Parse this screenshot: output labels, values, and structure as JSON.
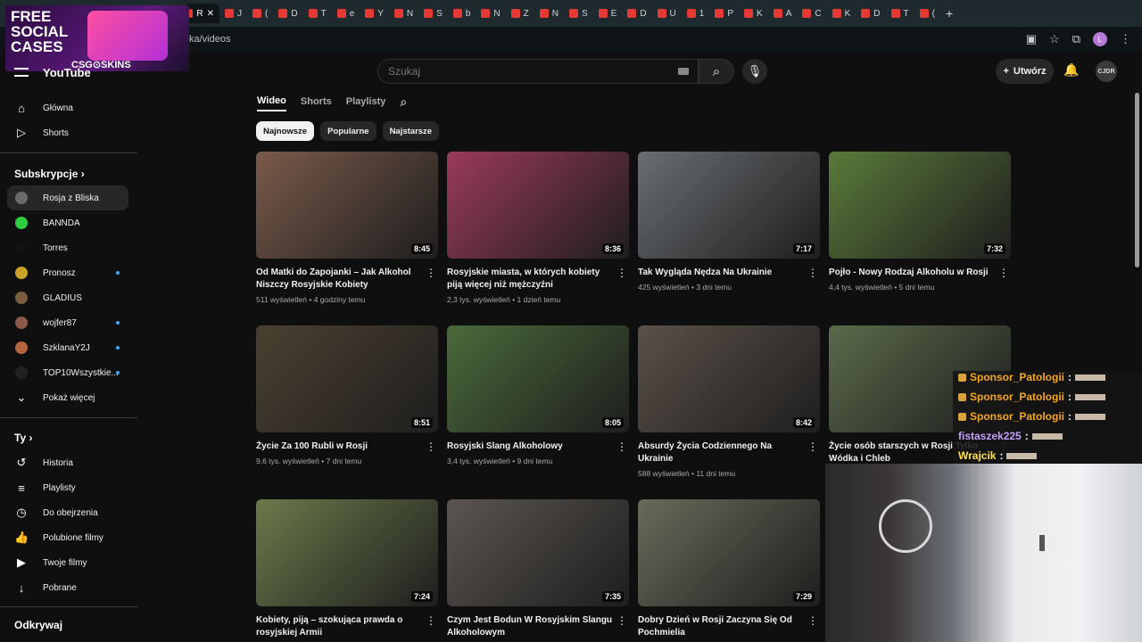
{
  "tabs": [
    {
      "label": "R",
      "active": true
    },
    {
      "label": "J"
    },
    {
      "label": "("
    },
    {
      "label": "D"
    },
    {
      "label": "T"
    },
    {
      "label": "e"
    },
    {
      "label": "Y"
    },
    {
      "label": "N"
    },
    {
      "label": "S"
    },
    {
      "label": "b"
    },
    {
      "label": "N"
    },
    {
      "label": "Z"
    },
    {
      "label": "N"
    },
    {
      "label": "S"
    },
    {
      "label": "E"
    },
    {
      "label": "D"
    },
    {
      "label": "U"
    },
    {
      "label": "1"
    },
    {
      "label": "P"
    },
    {
      "label": "K"
    },
    {
      "label": "A"
    },
    {
      "label": "C"
    },
    {
      "label": "K"
    },
    {
      "label": "D"
    },
    {
      "label": "T"
    },
    {
      "label": "("
    }
  ],
  "url": "ka/videos",
  "profile_letter": "L",
  "ad": {
    "title": "FREE\nSOCIAL\nCASES",
    "brand": "CSG⊙SKINS"
  },
  "header": {
    "logo": "YouTube",
    "search_placeholder": "Szukaj",
    "create_label": "Utwórz",
    "avatar_text": "CJDR"
  },
  "sidebar": {
    "main": [
      {
        "icon": "home-icon",
        "label": "Główna"
      },
      {
        "icon": "shorts-icon",
        "label": "Shorts"
      }
    ],
    "subs_heading": "Subskrypcje",
    "subscriptions": [
      {
        "label": "Rosja z Bliska",
        "color": "#6b6b6b",
        "selected": true,
        "dot": false
      },
      {
        "label": "BANNDA",
        "color": "#2ecc40",
        "dot": false
      },
      {
        "label": "Torres",
        "color": "#111111",
        "dot": false
      },
      {
        "label": "Pronosz",
        "color": "#c9a227",
        "dot": true
      },
      {
        "label": "GLADIUS",
        "color": "#7a5c3e",
        "dot": false
      },
      {
        "label": "wojfer87",
        "color": "#8b5a4a",
        "dot": true
      },
      {
        "label": "SzklanaY2J",
        "color": "#b5653f",
        "dot": true
      },
      {
        "label": "TOP10Wszystkie...",
        "color": "#222222",
        "dot": true
      }
    ],
    "show_more": "Pokaż więcej",
    "you_heading": "Ty",
    "you_items": [
      {
        "icon": "history-icon",
        "label": "Historia"
      },
      {
        "icon": "playlists-icon",
        "label": "Playlisty"
      },
      {
        "icon": "watch-later-icon",
        "label": "Do obejrzenia"
      },
      {
        "icon": "liked-icon",
        "label": "Polubione filmy"
      },
      {
        "icon": "your-videos-icon",
        "label": "Twoje filmy"
      },
      {
        "icon": "downloads-icon",
        "label": "Pobrane"
      }
    ],
    "explore_heading": "Odkrywaj"
  },
  "channel_tabs": [
    "Wideo",
    "Shorts",
    "Playlisty"
  ],
  "chips": [
    "Najnowsze",
    "Popularne",
    "Najstarsze"
  ],
  "videos": [
    {
      "title": "Od Matki do Zapojanki – Jak Alkohol Niszczy Rosyjskie Kobiety",
      "views": "511 wyświetleń",
      "age": "4 godziny temu",
      "duration": "8:45",
      "color": "#7a5a4a"
    },
    {
      "title": "Rosyjskie miasta, w których kobiety piją więcej niż mężczyźni",
      "views": "2,3 tys. wyświetleń",
      "age": "1 dzień temu",
      "duration": "8:36",
      "color": "#9a3a5a"
    },
    {
      "title": "Tak Wygląda Nędza Na Ukrainie",
      "views": "425 wyświetleń",
      "age": "3 dni temu",
      "duration": "7:17",
      "color": "#6a6e72"
    },
    {
      "title": "Pojło - Nowy Rodzaj Alkoholu w Rosji",
      "views": "4,4 tys. wyświetleń",
      "age": "5 dni temu",
      "duration": "7:32",
      "color": "#5a7a3a"
    },
    {
      "title": "Życie Za 100 Rubli w Rosji",
      "views": "9,6 tys. wyświetleń",
      "age": "7 dni temu",
      "duration": "8:51",
      "color": "#4a4030"
    },
    {
      "title": "Rosyjski Slang Alkoholowy",
      "views": "3,4 tys. wyświetleń",
      "age": "9 dni temu",
      "duration": "8:05",
      "color": "#4a6a3a"
    },
    {
      "title": "Absurdy Życia Codziennego Na Ukrainie",
      "views": "588 wyświetleń",
      "age": "11 dni temu",
      "duration": "8:42",
      "color": "#5a5048"
    },
    {
      "title": "Życie osób starszych w Rosji Tylko Wódka i Chleb",
      "views": "",
      "age": "",
      "duration": "",
      "color": "#5a6a4a"
    },
    {
      "title": "Kobiety, piją – szokująca prawda o rosyjskiej Armii",
      "views": "",
      "age": "",
      "duration": "7:24",
      "color": "#6a7a4a"
    },
    {
      "title": "Czym Jest Bodun W Rosyjskim Slangu Alkoholowym",
      "views": "",
      "age": "",
      "duration": "7:35",
      "color": "#5a5550"
    },
    {
      "title": "Dobry Dzień w Rosji Zaczyna Się Od Pochmielia",
      "views": "",
      "age": "",
      "duration": "7:29",
      "color": "#6a6a5a"
    }
  ],
  "chat": [
    {
      "user": "Sponsor_Patologii",
      "color": "#f5a623",
      "badge": true
    },
    {
      "user": "Sponsor_Patologii",
      "color": "#f5a623",
      "badge": true
    },
    {
      "user": "Sponsor_Patologii",
      "color": "#f5a623",
      "badge": true
    },
    {
      "user": "fistaszek225",
      "color": "#c8a0ff",
      "badge": false
    },
    {
      "user": "Wrajcik",
      "color": "#ffe14d",
      "badge": false
    }
  ]
}
